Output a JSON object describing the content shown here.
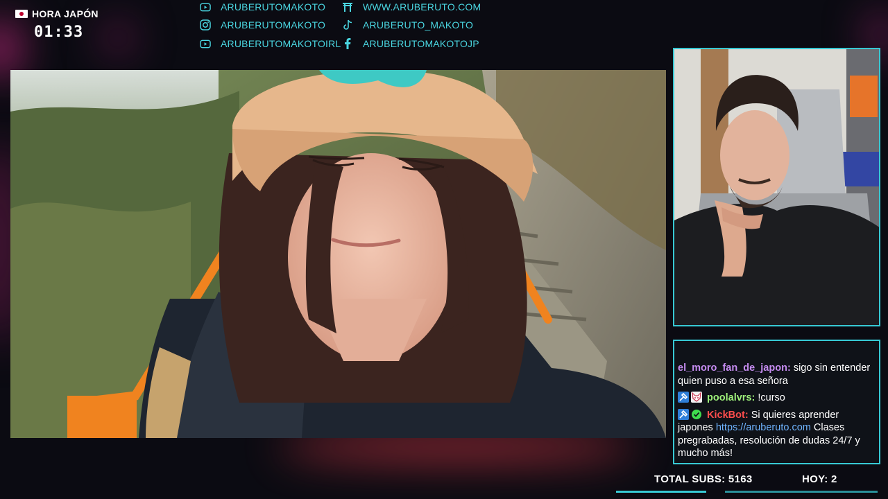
{
  "top_info": {
    "label": "HORA JAPÓN",
    "time": "01:33"
  },
  "socials": [
    {
      "icon": "youtube-icon",
      "text": "ARUBERUTOMAKOTO"
    },
    {
      "icon": "instagram-icon",
      "text": "ARUBERUTOMAKOTO"
    },
    {
      "icon": "youtube-icon",
      "text": "ARUBERUTOMAKOTOIRL"
    },
    {
      "icon": "torii-icon",
      "text": "WWW.ARUBERUTO.COM"
    },
    {
      "icon": "tiktok-icon",
      "text": "ARUBERUTO_MAKOTO"
    },
    {
      "icon": "facebook-icon",
      "text": "ARUBERUTOMAKOTOJP"
    }
  ],
  "chat": {
    "messages": [
      {
        "user": "el_moro_fan_de_japon",
        "user_color": "#c58cf0",
        "text": "sigo sin entender quien puso a esa señora",
        "badges": []
      },
      {
        "user": "poolalvrs",
        "user_color": "#9ef07a",
        "text": "!curso",
        "badges": [
          "hammer-badge-icon",
          "kitsune-badge-icon"
        ]
      },
      {
        "user": "KickBot",
        "user_color": "#ff4d4d",
        "text_before": "Si quieres aprender japones ",
        "link": "https://aruberuto.com",
        "text_after": " Clases pregrabadas, resolución de dudas 24/7 y mucho más!",
        "badges": [
          "hammer-badge-icon",
          "verified-badge-icon"
        ]
      }
    ]
  },
  "stats": {
    "total_subs_label": "TOTAL SUBS: 5163",
    "hoy_label": "HOY: 2"
  },
  "colors": {
    "accent": "#37c9d4",
    "social_text": "#4ad5e0",
    "background": "#0b0b12"
  }
}
